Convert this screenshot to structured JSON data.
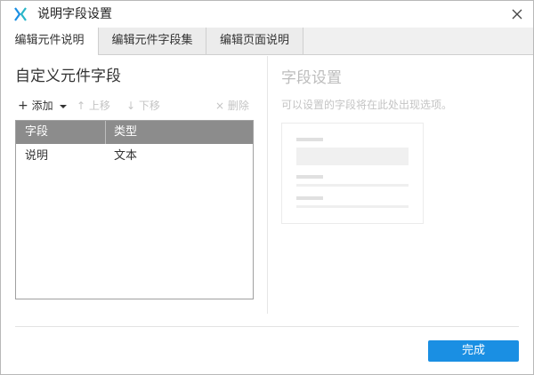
{
  "window": {
    "title": "说明字段设置",
    "app_icon": "axure-x-icon",
    "close_icon": "close-icon"
  },
  "tabs": [
    {
      "label": "编辑元件说明",
      "active": true
    },
    {
      "label": "编辑元件字段集",
      "active": false
    },
    {
      "label": "编辑页面说明",
      "active": false
    }
  ],
  "left_panel": {
    "title": "自定义元件字段",
    "toolbar": {
      "add_label": "添加",
      "up_label": "上移",
      "down_label": "下移",
      "delete_label": "删除"
    },
    "table": {
      "columns": [
        "字段",
        "类型"
      ],
      "rows": [
        {
          "field": "说明",
          "type": "文本"
        }
      ]
    }
  },
  "right_panel": {
    "title": "字段设置",
    "hint": "可以设置的字段将在此处出现选项。"
  },
  "footer": {
    "done_label": "完成"
  },
  "colors": {
    "accent": "#1a8fe3",
    "header_bg": "#8c8c8c",
    "disabled_text": "#c4c4c4"
  }
}
